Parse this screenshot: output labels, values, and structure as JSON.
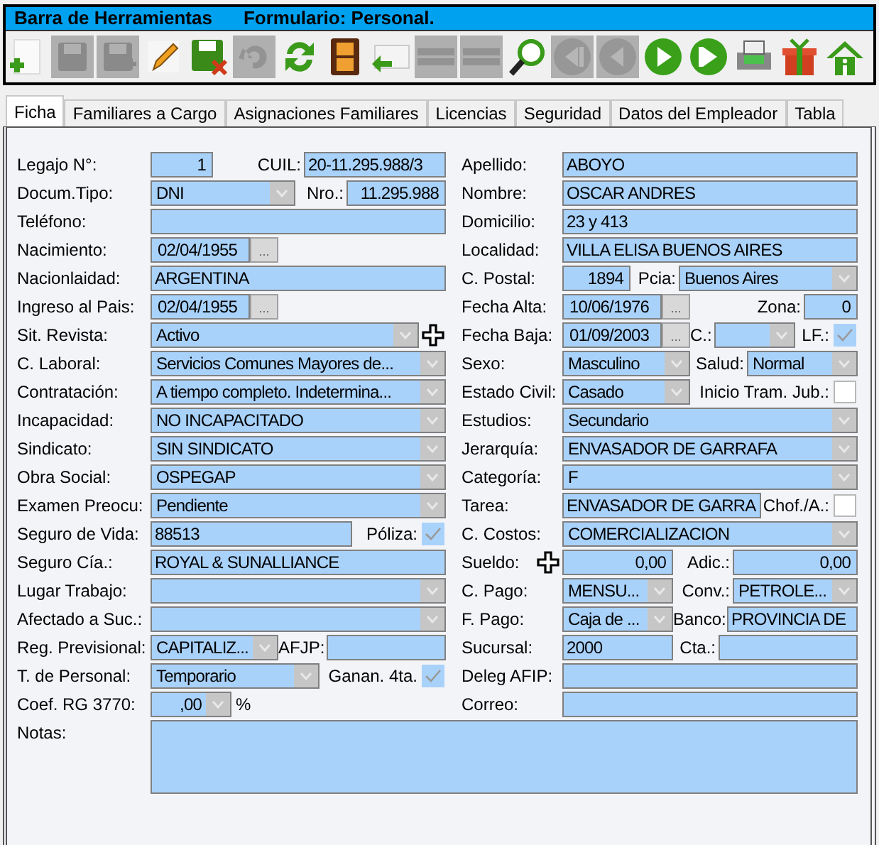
{
  "toolbar": {
    "title": "Barra de Herramientas",
    "form_title": "Formulario: Personal.",
    "tools": [
      {
        "kind": "new",
        "disabled": false
      },
      {
        "kind": "save",
        "disabled": true
      },
      {
        "kind": "save_as",
        "disabled": true
      },
      {
        "kind": "edit",
        "disabled": false
      },
      {
        "kind": "discard",
        "disabled": false
      },
      {
        "kind": "undo",
        "disabled": true
      },
      {
        "kind": "refresh",
        "disabled": false
      },
      {
        "kind": "film",
        "disabled": false
      },
      {
        "kind": "reply",
        "disabled": false
      },
      {
        "kind": "bar",
        "disabled": true
      },
      {
        "kind": "bar",
        "disabled": true
      },
      {
        "kind": "search",
        "disabled": false
      },
      {
        "kind": "first",
        "disabled": true
      },
      {
        "kind": "prev",
        "disabled": true
      },
      {
        "kind": "next",
        "disabled": false
      },
      {
        "kind": "last",
        "disabled": false
      },
      {
        "kind": "print",
        "disabled": false
      },
      {
        "kind": "gift",
        "disabled": false
      },
      {
        "kind": "home",
        "disabled": false
      }
    ]
  },
  "tabs": [
    {
      "label": "Ficha",
      "selected": true
    },
    {
      "label": "Familiares a Cargo",
      "selected": false
    },
    {
      "label": "Asignaciones Familiares",
      "selected": false
    },
    {
      "label": "Licencias",
      "selected": false
    },
    {
      "label": "Seguridad",
      "selected": false
    },
    {
      "label": "Datos del Empleador",
      "selected": false
    },
    {
      "label": "Tabla",
      "selected": false
    }
  ],
  "left": [
    {
      "label": "Legajo N°:",
      "parts": [
        {
          "kind": "number",
          "value": "1"
        },
        {
          "kind": "label",
          "text": "CUIL:"
        },
        {
          "kind": "text",
          "value": "20-11.295.988/3"
        }
      ]
    },
    {
      "label": "Docum.Tipo:",
      "parts": [
        {
          "kind": "combo",
          "value": "DNI"
        },
        {
          "kind": "label",
          "text": "Nro.:"
        },
        {
          "kind": "number",
          "value": "11.295.988"
        }
      ]
    },
    {
      "label": "Teléfono:",
      "parts": [
        {
          "kind": "text"
        }
      ]
    },
    {
      "label": "Nacimiento:",
      "parts": [
        {
          "kind": "date",
          "value": "02/04/1955",
          "button": "..."
        }
      ]
    },
    {
      "label": "Nacionlaidad:",
      "parts": [
        {
          "kind": "text",
          "value": "ARGENTINA"
        }
      ]
    },
    {
      "label": "Ingreso al Pais:",
      "parts": [
        {
          "kind": "date",
          "value": "02/04/1955",
          "button": "..."
        }
      ]
    },
    {
      "label": "Sit. Revista:",
      "parts": [
        {
          "kind": "combo",
          "value": "Activo"
        },
        {
          "kind": "plus"
        }
      ]
    },
    {
      "label": "C. Laboral:",
      "parts": [
        {
          "kind": "combo",
          "value": "Servicios Comunes Mayores de..."
        }
      ]
    },
    {
      "label": "Contratación:",
      "parts": [
        {
          "kind": "combo",
          "value": "A tiempo completo. Indetermina..."
        }
      ]
    },
    {
      "label": "Incapacidad:",
      "parts": [
        {
          "kind": "combo",
          "value": "NO INCAPACITADO"
        }
      ]
    },
    {
      "label": "Sindicato:",
      "parts": [
        {
          "kind": "combo",
          "value": "SIN SINDICATO"
        }
      ]
    },
    {
      "label": "Obra Social:",
      "parts": [
        {
          "kind": "combo",
          "value": "OSPEGAP"
        }
      ]
    },
    {
      "label": "Examen Preocu:",
      "parts": [
        {
          "kind": "combo",
          "value": "Pendiente"
        }
      ]
    },
    {
      "label": "Seguro de Vida:",
      "parts": [
        {
          "kind": "text",
          "value": "88513"
        },
        {
          "kind": "label",
          "text": "Póliza:"
        },
        {
          "kind": "check",
          "checked": true
        }
      ]
    },
    {
      "label": "Seguro Cía.:",
      "parts": [
        {
          "kind": "text",
          "value": "ROYAL & SUNALLIANCE"
        }
      ]
    },
    {
      "label": "Lugar Trabajo:",
      "parts": [
        {
          "kind": "combo"
        }
      ]
    },
    {
      "label": "Afectado a Suc.:",
      "parts": [
        {
          "kind": "combo"
        }
      ]
    },
    {
      "label": "Reg. Previsional:",
      "parts": [
        {
          "kind": "combo",
          "value": "CAPITALIZ..."
        },
        {
          "kind": "label",
          "text": "AFJP:"
        },
        {
          "kind": "text"
        }
      ]
    },
    {
      "label": "T. de Personal:",
      "parts": [
        {
          "kind": "combo",
          "value": "Temporario"
        },
        {
          "kind": "label",
          "text": "Ganan. 4ta."
        },
        {
          "kind": "check",
          "checked": true
        }
      ]
    },
    {
      "label": "Coef. RG 3770:",
      "parts": [
        {
          "kind": "numcombo",
          "value": ",00"
        },
        {
          "kind": "suffix",
          "text": "%"
        }
      ]
    }
  ],
  "right": [
    {
      "label": "Apellido:",
      "parts": [
        {
          "kind": "text",
          "value": "ABOYO"
        }
      ]
    },
    {
      "label": "Nombre:",
      "parts": [
        {
          "kind": "text",
          "value": "OSCAR ANDRES"
        }
      ]
    },
    {
      "label": "Domicilio:",
      "parts": [
        {
          "kind": "text",
          "value": "23 y 413"
        }
      ]
    },
    {
      "label": "Localidad:",
      "parts": [
        {
          "kind": "text",
          "value": "VILLA ELISA BUENOS AIRES"
        }
      ]
    },
    {
      "label": "C. Postal:",
      "parts": [
        {
          "kind": "number",
          "value": "1894"
        },
        {
          "kind": "label",
          "text": "Pcia:"
        },
        {
          "kind": "combo",
          "value": "Buenos Aires"
        }
      ]
    },
    {
      "label": "Fecha Alta:",
      "parts": [
        {
          "kind": "date",
          "value": "10/06/1976",
          "button": "..."
        },
        {
          "kind": "label",
          "text": "Zona:"
        },
        {
          "kind": "number",
          "value": "0"
        }
      ]
    },
    {
      "label": "Fecha Baja:",
      "parts": [
        {
          "kind": "date",
          "value": "01/09/2003",
          "button": "..."
        },
        {
          "kind": "label",
          "text": "C.:"
        },
        {
          "kind": "combo"
        },
        {
          "kind": "label",
          "text": "LF.:"
        },
        {
          "kind": "check",
          "checked": true
        }
      ]
    },
    {
      "label": "Sexo:",
      "parts": [
        {
          "kind": "combo",
          "value": "Masculino"
        },
        {
          "kind": "label",
          "text": "Salud:"
        },
        {
          "kind": "combo",
          "value": "Normal"
        }
      ]
    },
    {
      "label": "Estado Civil:",
      "parts": [
        {
          "kind": "combo",
          "value": "Casado"
        },
        {
          "kind": "label",
          "text": "Inicio Tram. Jub.:"
        },
        {
          "kind": "check",
          "checked": false
        }
      ]
    },
    {
      "label": "Estudios:",
      "parts": [
        {
          "kind": "combo",
          "value": "Secundario"
        }
      ]
    },
    {
      "label": "Jerarquía:",
      "parts": [
        {
          "kind": "combo",
          "value": "ENVASADOR DE GARRAFA"
        }
      ]
    },
    {
      "label": "Categoría:",
      "parts": [
        {
          "kind": "combo",
          "value": "F"
        }
      ]
    },
    {
      "label": "Tarea:",
      "parts": [
        {
          "kind": "text",
          "value": "ENVASADOR DE GARRA"
        },
        {
          "kind": "label",
          "text": "Chof./A.:"
        },
        {
          "kind": "check",
          "checked": false
        }
      ]
    },
    {
      "label": "C. Costos:",
      "parts": [
        {
          "kind": "combo",
          "value": "COMERCIALIZACION"
        }
      ]
    },
    {
      "label": "Sueldo:",
      "parts": [
        {
          "kind": "plus"
        },
        {
          "kind": "number",
          "value": "0,00"
        },
        {
          "kind": "label",
          "text": "Adic.:"
        },
        {
          "kind": "number",
          "value": "0,00"
        }
      ]
    },
    {
      "label": "C. Pago:",
      "parts": [
        {
          "kind": "combo",
          "value": "MENSU..."
        },
        {
          "kind": "label",
          "text": "Conv.:"
        },
        {
          "kind": "combo",
          "value": "PETROLE..."
        }
      ]
    },
    {
      "label": "F. Pago:",
      "parts": [
        {
          "kind": "combo",
          "value": "Caja de ..."
        },
        {
          "kind": "label",
          "text": "Banco:"
        },
        {
          "kind": "text",
          "value": "PROVINCIA DE"
        }
      ]
    },
    {
      "label": "Sucursal:",
      "parts": [
        {
          "kind": "text",
          "value": "2000"
        },
        {
          "kind": "label",
          "text": "Cta.:"
        },
        {
          "kind": "text"
        }
      ]
    },
    {
      "label": "Deleg AFIP:",
      "parts": [
        {
          "kind": "text"
        }
      ]
    },
    {
      "label": "Correo:",
      "parts": [
        {
          "kind": "text"
        }
      ]
    }
  ],
  "notes": {
    "label": "Notas:"
  }
}
